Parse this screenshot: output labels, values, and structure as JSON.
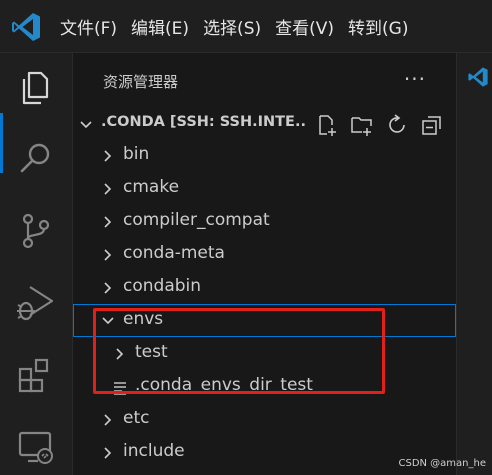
{
  "menu": {
    "items": [
      "文件(F)",
      "编辑(E)",
      "选择(S)",
      "查看(V)",
      "转到(G)"
    ]
  },
  "activity": {
    "icons": [
      "explorer-icon",
      "search-icon",
      "source-control-icon",
      "run-debug-icon",
      "extensions-icon",
      "remote-explorer-icon"
    ]
  },
  "explorer": {
    "title": "资源管理器",
    "more": "···",
    "folder_title": ".CONDA [SSH: SSH.INTE...",
    "items": [
      {
        "label": "bin"
      },
      {
        "label": "cmake"
      },
      {
        "label": "compiler_compat"
      },
      {
        "label": "conda-meta"
      },
      {
        "label": "condabin"
      },
      {
        "label": "envs"
      },
      {
        "label": "test"
      },
      {
        "label": ".conda_envs_dir_test"
      },
      {
        "label": "etc"
      },
      {
        "label": "include"
      }
    ]
  },
  "colors": {
    "accent": "#0078d4",
    "highlight_box": "#e0201a",
    "vscode_blue": "#2489ca"
  },
  "watermark": "CSDN @aman_he"
}
